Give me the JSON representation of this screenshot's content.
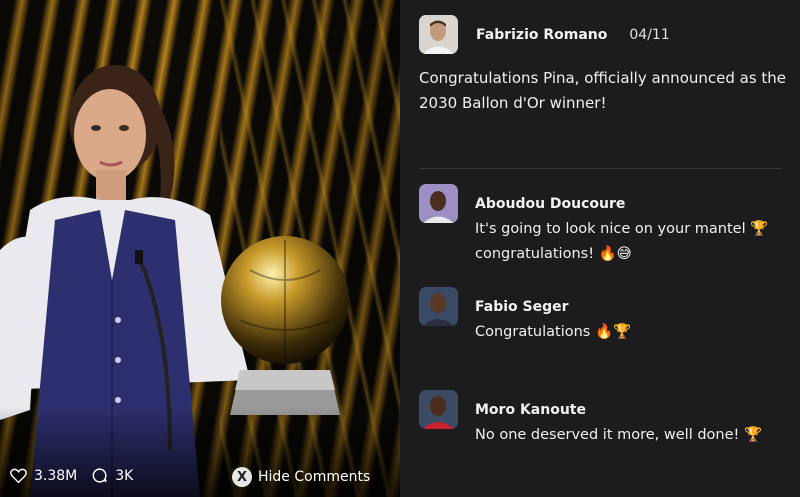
{
  "media": {
    "likes": "3.38M",
    "comments": "3K",
    "hide_label": "Hide Comments",
    "hide_key": "X"
  },
  "post": {
    "author": "Fabrizio Romano",
    "date": "04/11",
    "text": "Congratulations Pina, officially announced as the 2030 Ballon d'Or winner!"
  },
  "comments": [
    {
      "author": "Aboudou Doucoure",
      "line1": "It's going to look nice on your mantel 🏆",
      "line2": "congratulations! 🔥😅"
    },
    {
      "author": "Fabio Seger",
      "line1": "Congratulations 🔥🏆",
      "line2": ""
    },
    {
      "author": "Moro Kanoute",
      "line1": "No one deserved it more, well done! 🏆",
      "line2": ""
    }
  ]
}
